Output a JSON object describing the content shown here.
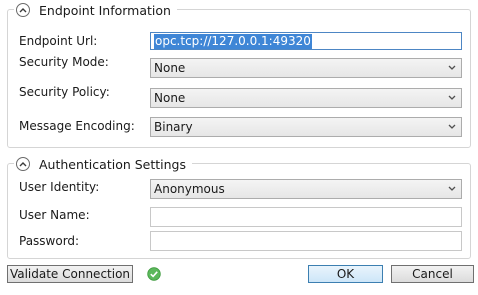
{
  "endpoint": {
    "title": "Endpoint Information",
    "url_label": "Endpoint Url:",
    "url_value": "opc.tcp://127.0.0.1:49320",
    "security_mode_label": "Security Mode:",
    "security_mode_value": "None",
    "security_policy_label": "Security Policy:",
    "security_policy_value": "None",
    "encoding_label": "Message Encoding:",
    "encoding_value": "Binary"
  },
  "auth": {
    "title": "Authentication Settings",
    "identity_label": "User Identity:",
    "identity_value": "Anonymous",
    "username_label": "User Name:",
    "username_value": "",
    "password_label": "Password:",
    "password_value": ""
  },
  "footer": {
    "validate_label": "Validate Connection",
    "ok_label": "OK",
    "cancel_label": "Cancel"
  },
  "icons": {
    "collapse": "chevron-up-icon",
    "dropdown": "chevron-down-icon",
    "validation_status": "check-circle-icon"
  },
  "colors": {
    "selection": "#3f86d6",
    "status_ok": "#5cb85c"
  }
}
